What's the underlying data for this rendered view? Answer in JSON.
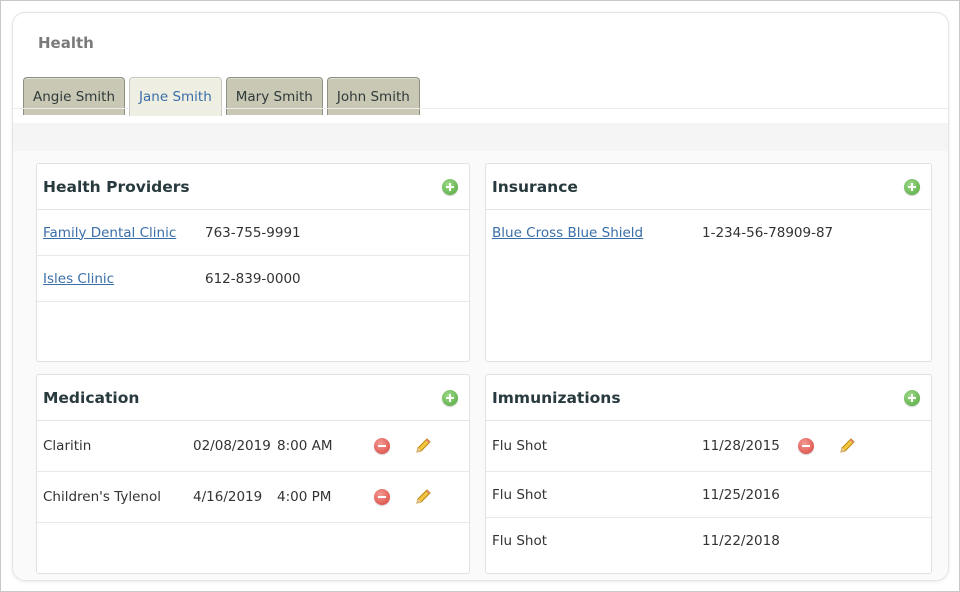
{
  "page": {
    "title": "Health"
  },
  "tabs": [
    {
      "label": "Angie Smith",
      "active": false
    },
    {
      "label": "Jane Smith",
      "active": true
    },
    {
      "label": "Mary Smith",
      "active": false
    },
    {
      "label": "John Smith",
      "active": false
    }
  ],
  "icons": {
    "add": "plus-circle-green",
    "remove": "minus-circle-red",
    "edit": "pencil"
  },
  "colors": {
    "link": "#3a6ea8",
    "tab_inactive": "#c9c8b4",
    "tab_active": "#eeeee2",
    "add": "#4ea63a",
    "remove": "#d8433a"
  },
  "health_providers": {
    "title": "Health Providers",
    "rows": [
      {
        "name": "Family Dental Clinic",
        "phone": "763-755-9991"
      },
      {
        "name": "Isles Clinic",
        "phone": "612-839-0000"
      }
    ]
  },
  "insurance": {
    "title": "Insurance",
    "rows": [
      {
        "name": "Blue Cross Blue Shield",
        "number": "1-234-56-78909-87"
      }
    ]
  },
  "medication": {
    "title": "Medication",
    "rows": [
      {
        "name": "Claritin",
        "date": "02/08/2019",
        "time": "8:00 AM"
      },
      {
        "name": "Children's Tylenol",
        "date": "4/16/2019",
        "time": "4:00 PM"
      }
    ]
  },
  "immunizations": {
    "title": "Immunizations",
    "rows": [
      {
        "name": "Flu Shot",
        "date": "11/28/2015"
      },
      {
        "name": "Flu Shot",
        "date": "11/25/2016"
      },
      {
        "name": "Flu Shot",
        "date": "11/22/2018"
      }
    ]
  }
}
